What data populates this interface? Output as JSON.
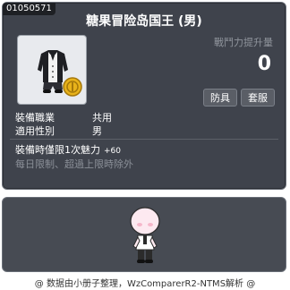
{
  "item": {
    "id": "01050571",
    "name": "糖果冒险岛国王 (男)"
  },
  "stats": {
    "label": "戰鬥力提升量",
    "value": "0"
  },
  "tags": {
    "armor": "防具",
    "set": "套服"
  },
  "info": [
    {
      "key": "裝備職業",
      "value": "共用"
    },
    {
      "key": "適用性別",
      "value": "男"
    }
  ],
  "limit": {
    "text": "裝備時僅限1次魅力",
    "bonus": "+60",
    "notice": "每日限制、超過上限時除外"
  },
  "footer": "@ 数据由小册子整理，WzComparerR2-NTMS解析 @",
  "colors": {
    "panel": "#3f434c",
    "preview": "#474b53",
    "muted": "#8f949c",
    "coin": "#e8b21a"
  }
}
